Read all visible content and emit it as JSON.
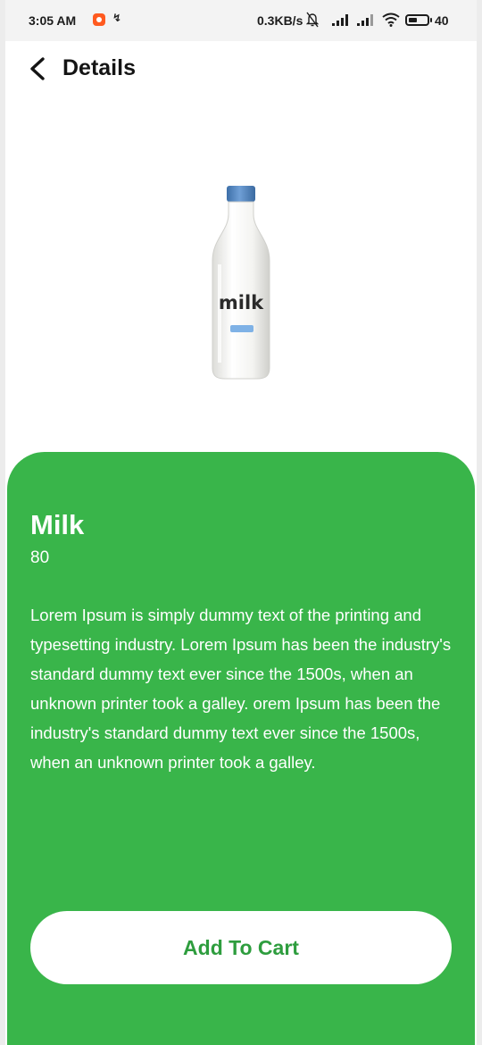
{
  "status_bar": {
    "time": "3:05 AM",
    "network_speed": "0.3KB/s",
    "battery_level": "40"
  },
  "header": {
    "title": "Details"
  },
  "product": {
    "image_label": "milk",
    "name": "Milk",
    "price": "80",
    "description": "Lorem Ipsum is simply dummy text of the printing and typesetting industry. Lorem Ipsum has been the industry's standard dummy text ever since the 1500s, when an unknown printer took a galley. orem Ipsum has been the industry's standard dummy text ever since the 1500s, when an unknown printer took a galley.",
    "add_to_cart_label": "Add To Cart"
  },
  "colors": {
    "accent_green": "#39b54a",
    "button_text_green": "#2e9d3e",
    "background": "#ffffff",
    "cap_blue": "#4f86c6"
  },
  "icons": {
    "back": "chevron-left-icon",
    "recorder": "screen-record-icon",
    "bolt": "charging-bolt-icon",
    "mute": "bell-off-icon",
    "signal": "signal-icon",
    "wifi": "wifi-icon",
    "battery": "battery-icon"
  }
}
